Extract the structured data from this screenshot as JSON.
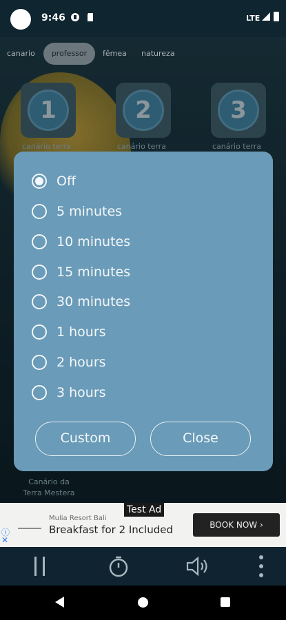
{
  "status_bar": {
    "time": "9:46",
    "network": "LTE"
  },
  "tabs": [
    {
      "label": "canario",
      "active": false
    },
    {
      "label": "professor",
      "active": true
    },
    {
      "label": "fêmea",
      "active": false
    },
    {
      "label": "natureza",
      "active": false
    }
  ],
  "tiles": [
    {
      "number": "1",
      "caption": "canário terra"
    },
    {
      "number": "2",
      "caption": "canário terra"
    },
    {
      "number": "3",
      "caption": "canário terra"
    }
  ],
  "bottom_caption": "Canário da Terra Mestera",
  "dialog": {
    "options": [
      {
        "label": "Off",
        "selected": true
      },
      {
        "label": "5 minutes",
        "selected": false
      },
      {
        "label": "10 minutes",
        "selected": false
      },
      {
        "label": "15 minutes",
        "selected": false
      },
      {
        "label": "30 minutes",
        "selected": false
      },
      {
        "label": "1 hours",
        "selected": false
      },
      {
        "label": "2 hours",
        "selected": false
      },
      {
        "label": "3 hours",
        "selected": false
      }
    ],
    "custom_label": "Custom",
    "close_label": "Close"
  },
  "ad": {
    "badge": "Test Ad",
    "advertiser": "Mulia Resort Bali",
    "headline": "Breakfast for 2 Included",
    "cta": "BOOK NOW ›"
  },
  "icons": [
    "pause-icon",
    "timer-icon",
    "volume-icon",
    "more-vert-icon"
  ],
  "colors": {
    "dialog_bg": "#6a9bb8",
    "accent": "#3e7b98"
  }
}
